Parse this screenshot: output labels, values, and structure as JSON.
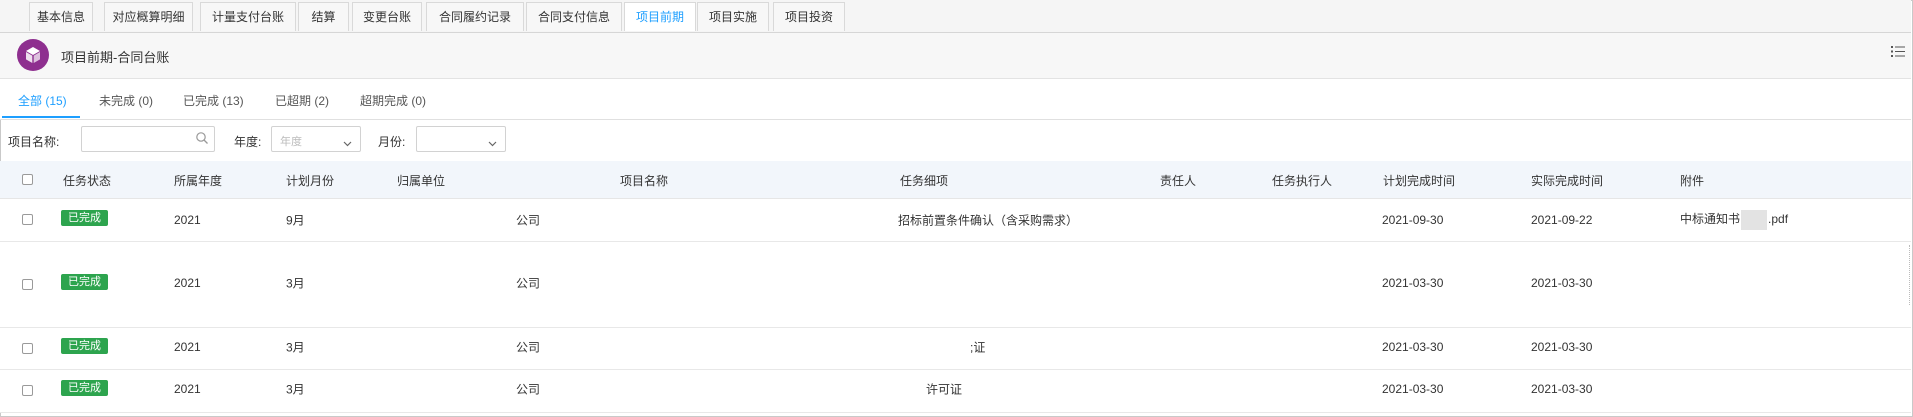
{
  "top_tabs": [
    {
      "label": "基本信息"
    },
    {
      "label": "对应概算明细"
    },
    {
      "label": "计量支付台账"
    },
    {
      "label": "结算"
    },
    {
      "label": "变更台账"
    },
    {
      "label": "合同履约记录"
    },
    {
      "label": "合同支付信息"
    },
    {
      "label": "项目前期",
      "active": true
    },
    {
      "label": "项目实施"
    },
    {
      "label": "项目投资"
    }
  ],
  "header": {
    "title": "项目前期-合同台账",
    "logo_icon": "cube-icon",
    "menu_icon": "list-icon",
    "logo_color": "#8e2f8f"
  },
  "sub_tabs": [
    {
      "label": "全部 (15)",
      "active": true
    },
    {
      "label": "未完成 (0)"
    },
    {
      "label": "已完成 (13)"
    },
    {
      "label": "已超期 (2)"
    },
    {
      "label": "超期完成 (0)"
    }
  ],
  "filters": {
    "project_name_label": "项目名称:",
    "project_name_value": "",
    "year_label": "年度:",
    "year_placeholder": "年度",
    "month_label": "月份:",
    "month_value": ""
  },
  "table": {
    "columns": [
      "任务状态",
      "所属年度",
      "计划月份",
      "归属单位",
      "项目名称",
      "任务细项",
      "责任人",
      "任务执行人",
      "计划完成时间",
      "实际完成时间",
      "附件"
    ],
    "rows": [
      {
        "status": "已完成",
        "year": "2021",
        "month": "9月",
        "unit": "公司",
        "project": "",
        "task": "招标前置条件确认（含采购需求）",
        "owner": "",
        "executor": "",
        "plan_date": "2021-09-30",
        "actual_date": "2021-09-22",
        "attachment_prefix": "中标通知书",
        "attachment_suffix": ".pdf"
      },
      {
        "status": "已完成",
        "year": "2021",
        "month": "3月",
        "unit": "公司",
        "project": "",
        "task": "",
        "owner": "",
        "executor": "",
        "plan_date": "2021-03-30",
        "actual_date": "2021-03-30",
        "attachment_prefix": "",
        "attachment_suffix": ""
      },
      {
        "status": "已完成",
        "year": "2021",
        "month": "3月",
        "unit": "公司",
        "project": "",
        "task": ";证",
        "owner": "",
        "executor": "",
        "plan_date": "2021-03-30",
        "actual_date": "2021-03-30",
        "attachment_prefix": "",
        "attachment_suffix": ""
      },
      {
        "status": "已完成",
        "year": "2021",
        "month": "3月",
        "unit": "公司",
        "project": "",
        "task": "许可证",
        "owner": "",
        "executor": "",
        "plan_date": "2021-03-30",
        "actual_date": "2021-03-30",
        "attachment_prefix": "",
        "attachment_suffix": ""
      }
    ]
  },
  "colors": {
    "accent": "#1e9fff",
    "status_done": "#2da44e"
  }
}
